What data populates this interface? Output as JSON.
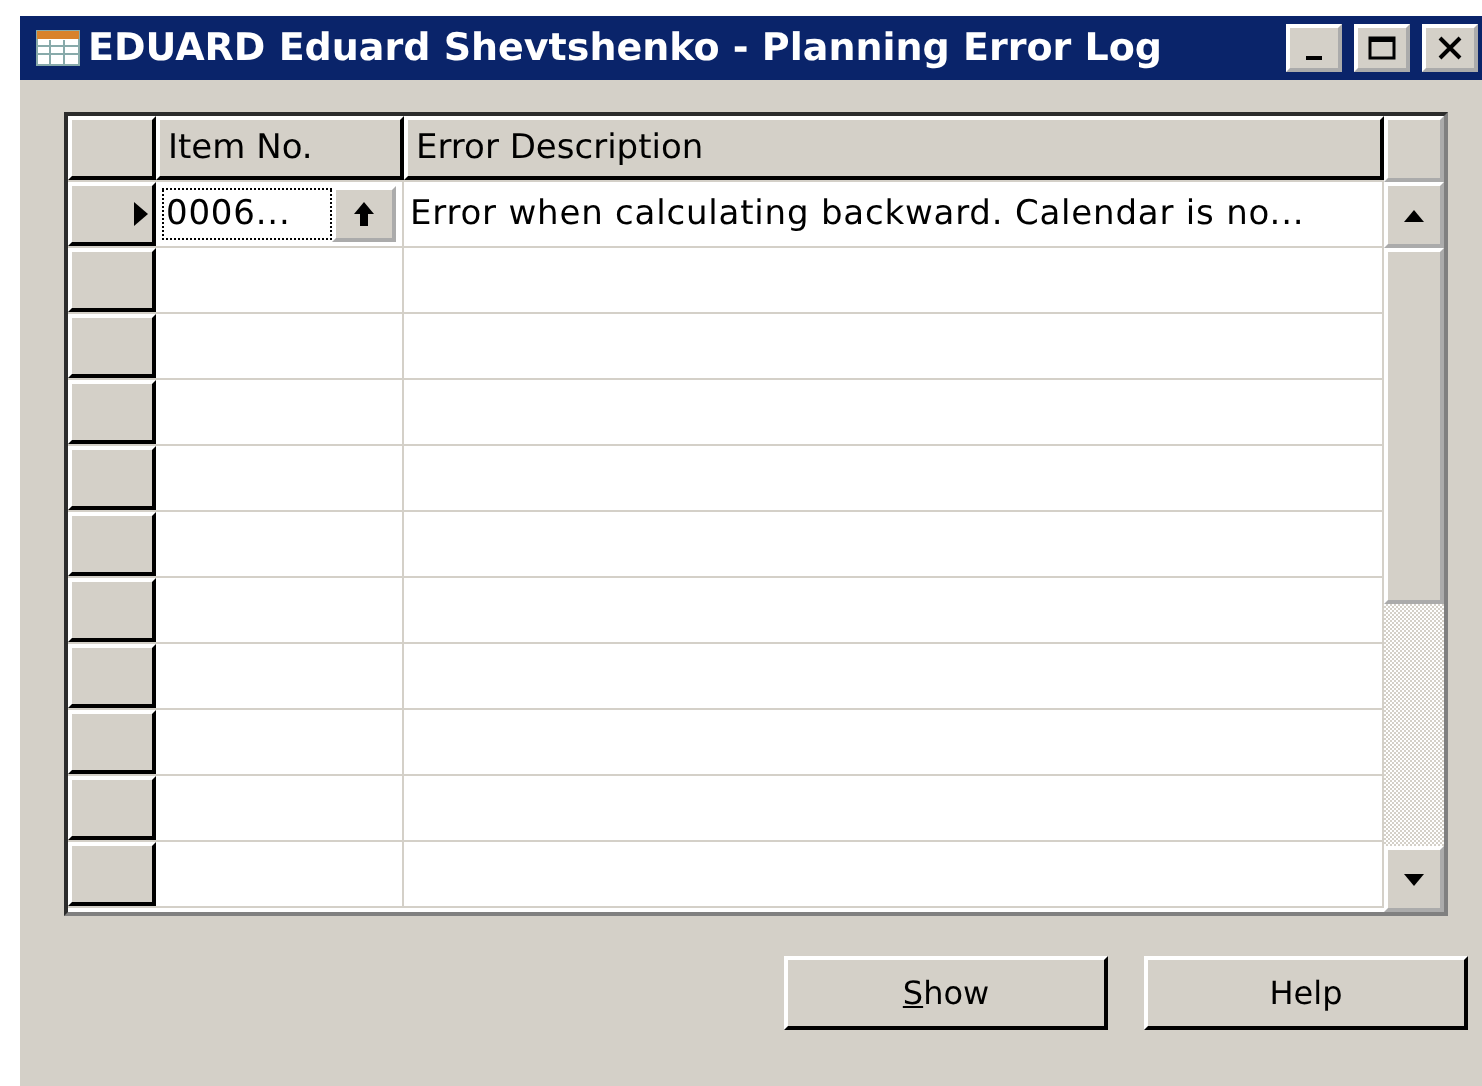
{
  "window": {
    "title": "EDUARD Eduard Shevtshenko - Planning Error Log"
  },
  "table": {
    "columns": [
      "Item No.",
      "Error Description"
    ],
    "rows": [
      {
        "selected": true,
        "item_no": "0006...",
        "error_description": "Error when calculating backward. Calendar is no..."
      }
    ]
  },
  "buttons": [
    {
      "label": "Show",
      "access_key": true
    },
    {
      "label": "Help",
      "access_key": false
    }
  ]
}
